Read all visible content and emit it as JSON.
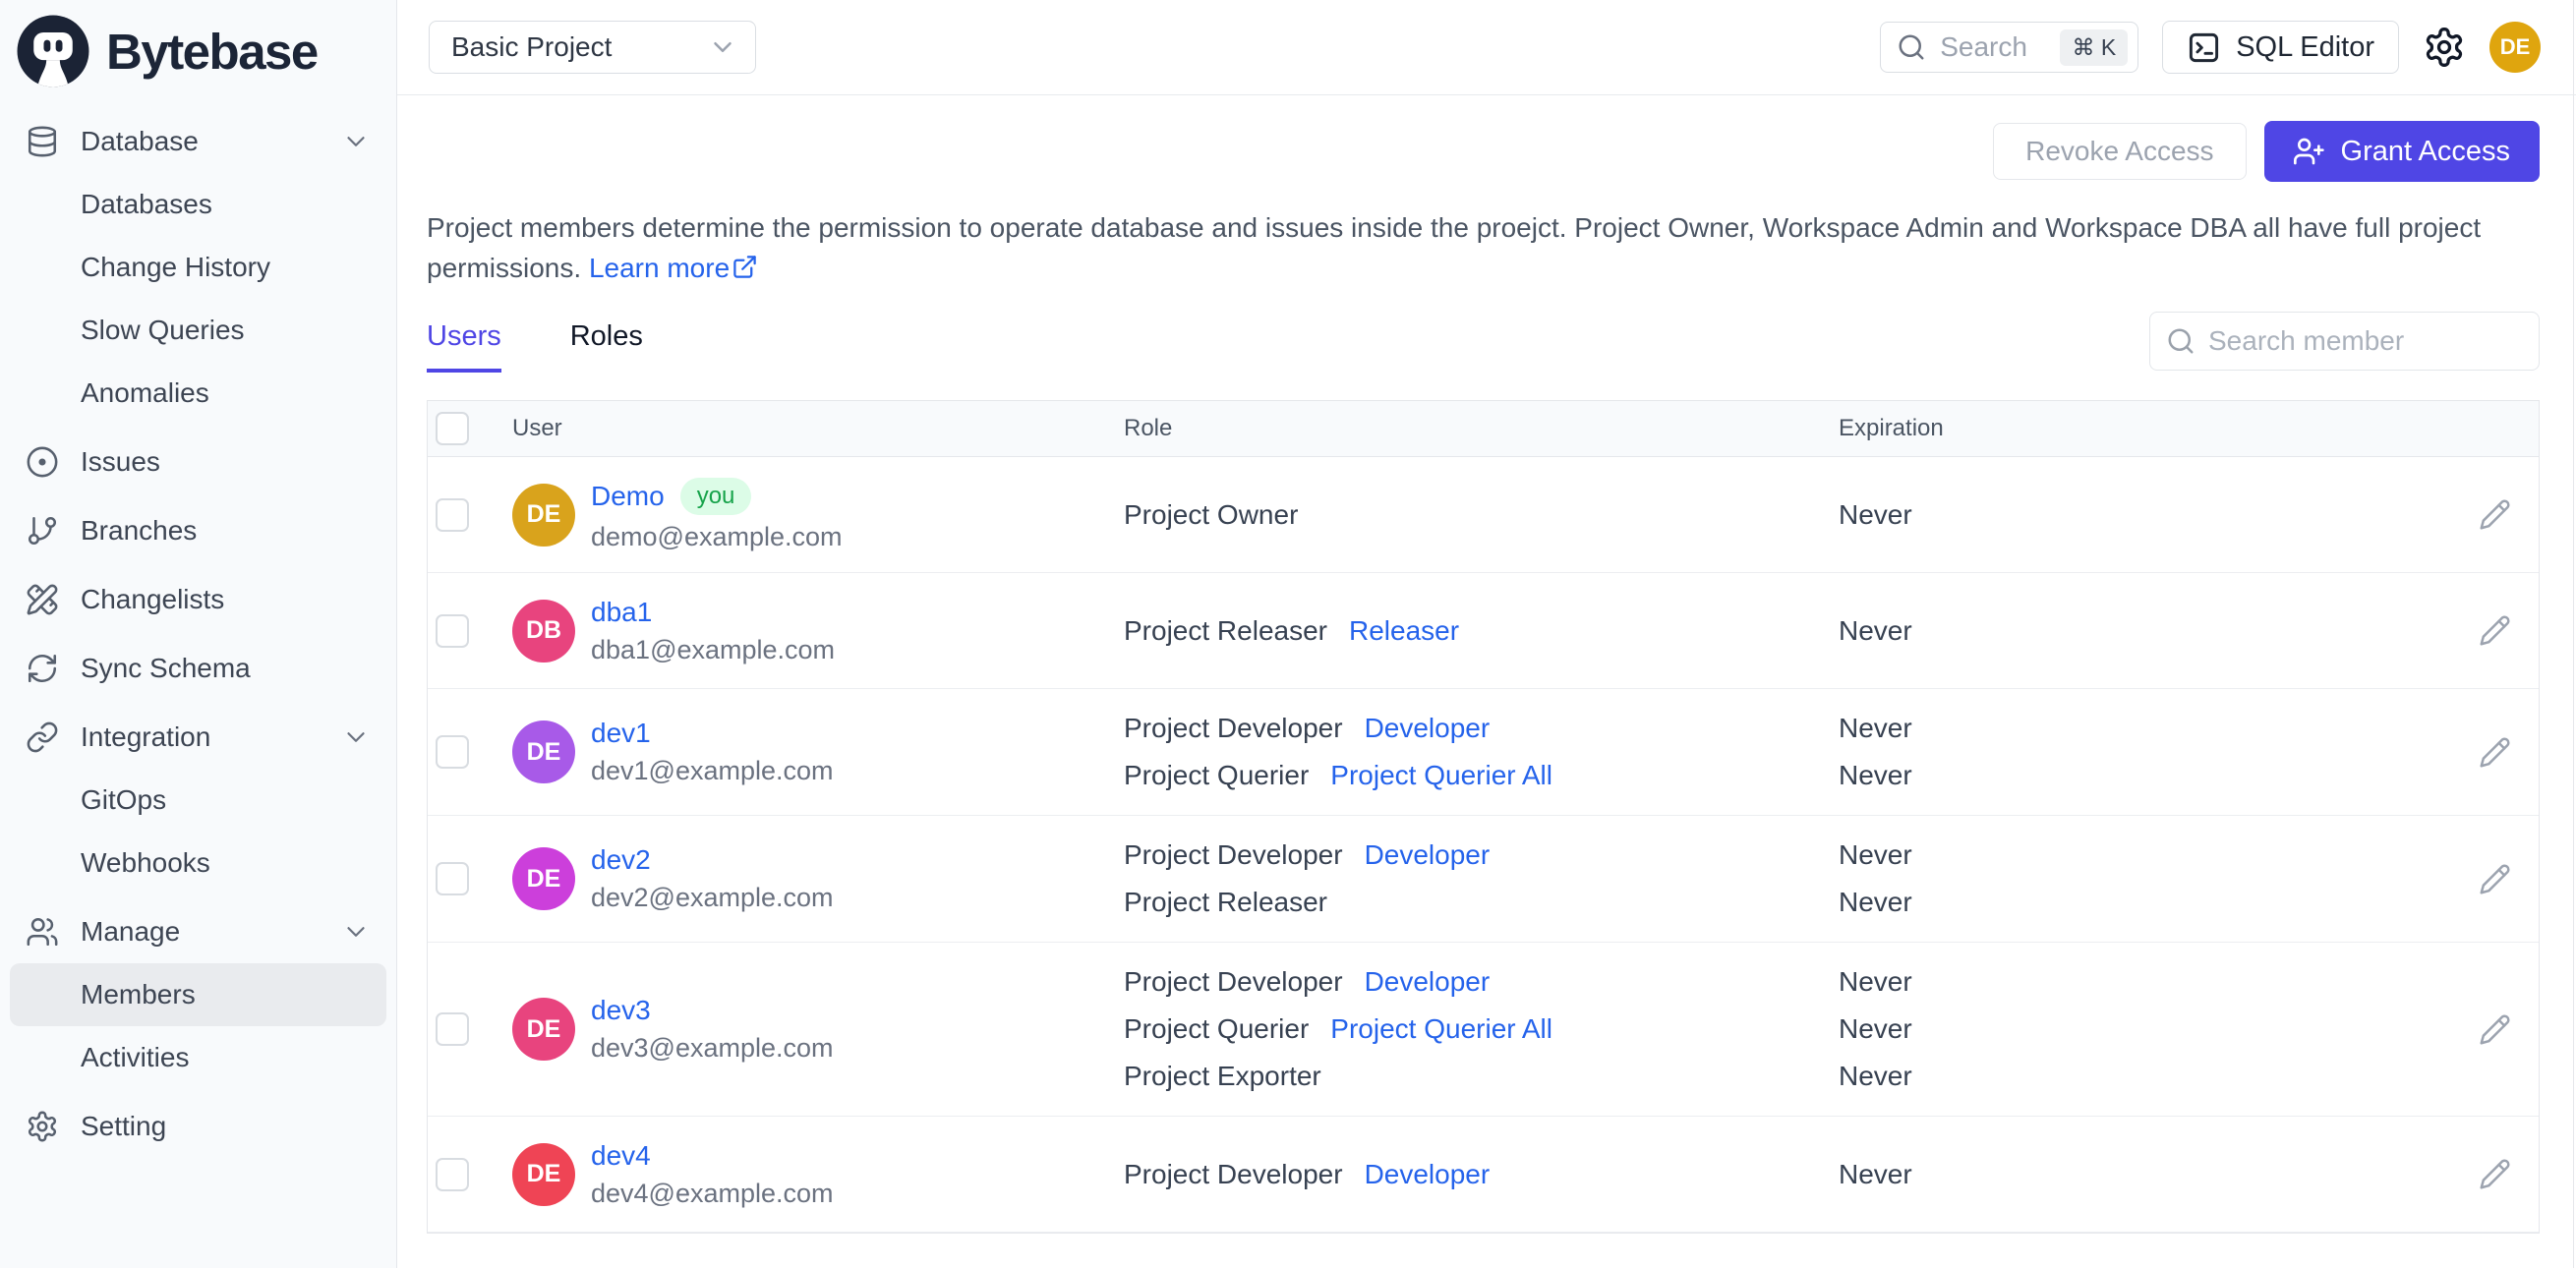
{
  "brand": {
    "name": "Bytebase"
  },
  "sidebar": {
    "items": [
      {
        "label": "Database",
        "icon": "database-icon",
        "type": "group",
        "chevron": true
      },
      {
        "label": "Databases",
        "type": "sub"
      },
      {
        "label": "Change History",
        "type": "sub"
      },
      {
        "label": "Slow Queries",
        "type": "sub"
      },
      {
        "label": "Anomalies",
        "type": "sub"
      },
      {
        "label": "Issues",
        "icon": "circle-dot-icon",
        "type": "group"
      },
      {
        "label": "Branches",
        "icon": "git-branch-icon",
        "type": "group"
      },
      {
        "label": "Changelists",
        "icon": "pencil-ruler-icon",
        "type": "group"
      },
      {
        "label": "Sync Schema",
        "icon": "sync-icon",
        "type": "group"
      },
      {
        "label": "Integration",
        "icon": "link-icon",
        "type": "group",
        "chevron": true
      },
      {
        "label": "GitOps",
        "type": "sub"
      },
      {
        "label": "Webhooks",
        "type": "sub"
      },
      {
        "label": "Manage",
        "icon": "users-icon",
        "type": "group",
        "chevron": true
      },
      {
        "label": "Members",
        "type": "sub",
        "active": true
      },
      {
        "label": "Activities",
        "type": "sub"
      },
      {
        "label": "Setting",
        "icon": "gear-icon",
        "type": "group"
      }
    ]
  },
  "header": {
    "project_select": "Basic Project",
    "search_placeholder": "Search",
    "search_shortcut": "⌘ K",
    "sql_editor_label": "SQL Editor",
    "avatar_initials": "DE",
    "avatar_color": "#DFA50E"
  },
  "actions": {
    "revoke_label": "Revoke Access",
    "grant_label": "Grant Access"
  },
  "intro": {
    "description": "Project members determine the permission to operate database and issues inside the proejct. Project Owner, Workspace Admin and Workspace DBA all have full project permissions.",
    "learn_more_label": "Learn more"
  },
  "tabs": [
    {
      "label": "Users",
      "active": true
    },
    {
      "label": "Roles",
      "active": false
    }
  ],
  "members": {
    "search_placeholder": "Search member",
    "columns": [
      "User",
      "Role",
      "Expiration"
    ],
    "rows": [
      {
        "initials": "DE",
        "avatar_color": "#D9A31C",
        "name": "Demo",
        "you_badge": "you",
        "email": "demo@example.com",
        "roles": [
          {
            "role": "Project Owner",
            "link": null
          }
        ],
        "expirations": [
          "Never"
        ]
      },
      {
        "initials": "DB",
        "avatar_color": "#E8447E",
        "name": "dba1",
        "you_badge": null,
        "email": "dba1@example.com",
        "roles": [
          {
            "role": "Project Releaser",
            "link": "Releaser"
          }
        ],
        "expirations": [
          "Never"
        ]
      },
      {
        "initials": "DE",
        "avatar_color": "#A85AE8",
        "name": "dev1",
        "you_badge": null,
        "email": "dev1@example.com",
        "roles": [
          {
            "role": "Project Developer",
            "link": "Developer"
          },
          {
            "role": "Project Querier",
            "link": "Project Querier All"
          }
        ],
        "expirations": [
          "Never",
          "Never"
        ]
      },
      {
        "initials": "DE",
        "avatar_color": "#CC3FDB",
        "name": "dev2",
        "you_badge": null,
        "email": "dev2@example.com",
        "roles": [
          {
            "role": "Project Developer",
            "link": "Developer"
          },
          {
            "role": "Project Releaser",
            "link": null
          }
        ],
        "expirations": [
          "Never",
          "Never"
        ]
      },
      {
        "initials": "DE",
        "avatar_color": "#E8447E",
        "name": "dev3",
        "you_badge": null,
        "email": "dev3@example.com",
        "roles": [
          {
            "role": "Project Developer",
            "link": "Developer"
          },
          {
            "role": "Project Querier",
            "link": "Project Querier All"
          },
          {
            "role": "Project Exporter",
            "link": null
          }
        ],
        "expirations": [
          "Never",
          "Never",
          "Never"
        ]
      },
      {
        "initials": "DE",
        "avatar_color": "#EF4455",
        "name": "dev4",
        "you_badge": null,
        "email": "dev4@example.com",
        "roles": [
          {
            "role": "Project Developer",
            "link": "Developer"
          }
        ],
        "expirations": [
          "Never"
        ]
      }
    ]
  },
  "colors": {
    "accent": "#4F46E5",
    "link": "#2563EB",
    "badge_bg": "#DCFCE7",
    "badge_text": "#16A34A"
  }
}
